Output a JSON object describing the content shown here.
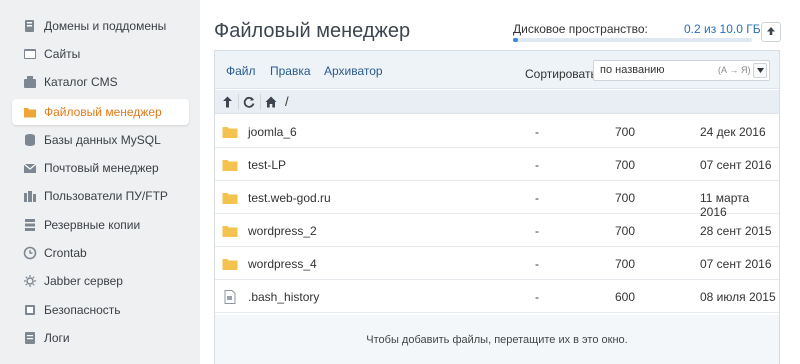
{
  "sidebar": {
    "items": [
      {
        "label": "Домены и поддомены",
        "icon": "domains-icon"
      },
      {
        "label": "Сайты",
        "icon": "sites-icon"
      },
      {
        "label": "Каталог CMS",
        "icon": "cms-catalog-icon"
      },
      {
        "label": "Файловый менеджер",
        "icon": "folder-icon",
        "active": true
      },
      {
        "label": "Базы данных MySQL",
        "icon": "database-icon"
      },
      {
        "label": "Почтовый менеджер",
        "icon": "mail-icon"
      },
      {
        "label": "Пользователи ПУ/FTP",
        "icon": "users-icon"
      },
      {
        "label": "Резервные копии",
        "icon": "backup-icon"
      },
      {
        "label": "Crontab",
        "icon": "clock-icon"
      },
      {
        "label": "Jabber сервер",
        "icon": "jabber-icon"
      },
      {
        "label": "Безопасность",
        "icon": "shield-icon"
      },
      {
        "label": "Логи",
        "icon": "logs-icon"
      }
    ]
  },
  "header": {
    "title": "Файловый менеджер",
    "disk_label": "Дисковое пространство:",
    "disk_value": "0.2 из 10.0 ГБ",
    "disk_used_fraction": 0.02
  },
  "toolbar": {
    "menu": [
      "Файл",
      "Правка",
      "Архиватор"
    ],
    "sort_label": "Сортировать:",
    "sort_value": "по названию",
    "sort_hint": "(А → Я)"
  },
  "path": {
    "current": "/"
  },
  "files": [
    {
      "name": "joomla_6",
      "size": "-",
      "perm": "700",
      "date": "24 дек 2016",
      "type": "folder"
    },
    {
      "name": "test-LP",
      "size": "-",
      "perm": "700",
      "date": "07 сент 2016",
      "type": "folder"
    },
    {
      "name": "test.web-god.ru",
      "size": "-",
      "perm": "700",
      "date": "11 марта 2016",
      "type": "folder"
    },
    {
      "name": "wordpress_2",
      "size": "-",
      "perm": "700",
      "date": "28 сент 2015",
      "type": "folder"
    },
    {
      "name": "wordpress_4",
      "size": "-",
      "perm": "700",
      "date": "07 сент 2016",
      "type": "folder"
    },
    {
      "name": ".bash_history",
      "size": "-",
      "perm": "600",
      "date": "08 июля 2015",
      "type": "file"
    }
  ],
  "dropzone": {
    "text": "Чтобы добавить файлы, перетащите их в это окно."
  },
  "colors": {
    "accent": "#e07a1b",
    "link": "#2a5a8a",
    "folder": "#f3c24f"
  }
}
